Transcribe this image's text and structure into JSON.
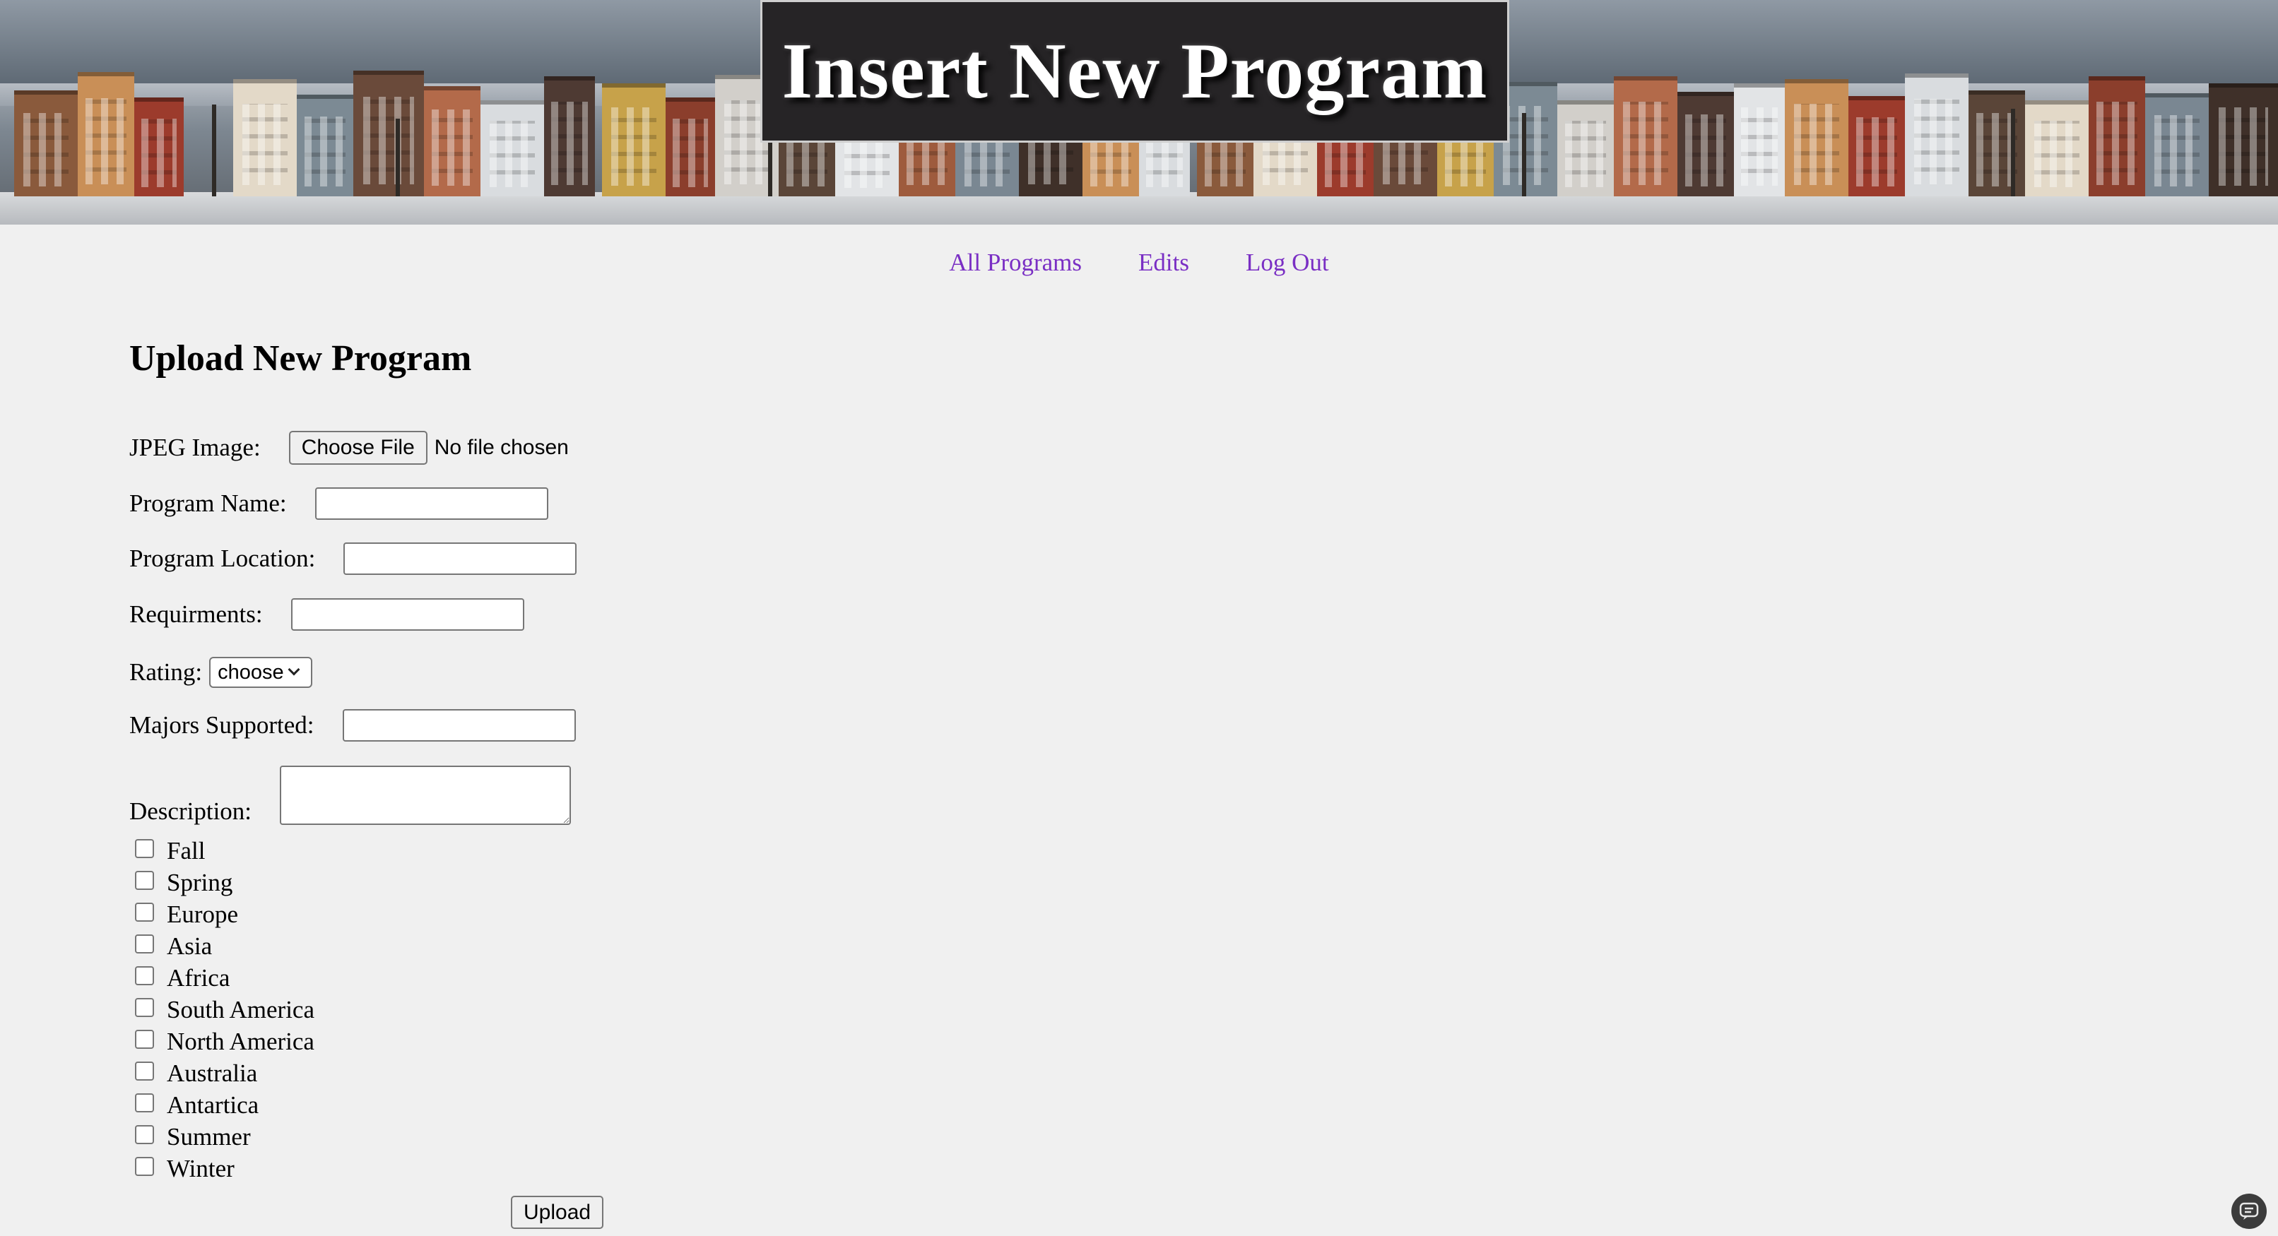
{
  "header": {
    "title": "Insert New Program"
  },
  "nav": {
    "items": [
      {
        "label": "All Programs"
      },
      {
        "label": "Edits"
      },
      {
        "label": "Log Out"
      }
    ]
  },
  "form": {
    "heading": "Upload New Program",
    "jpeg_label": "JPEG Image:",
    "file_button_label": "Choose File",
    "file_status": "No file chosen",
    "program_name_label": "Program Name:",
    "program_name_value": "",
    "program_location_label": "Program Location:",
    "program_location_value": "",
    "requirements_label": "Requirments:",
    "requirements_value": "",
    "rating_label": "Rating:",
    "rating_selected": "choose",
    "majors_label": "Majors Supported:",
    "majors_value": "",
    "description_label": "Description:",
    "description_value": "",
    "checkboxes": [
      {
        "label": "Fall",
        "checked": false
      },
      {
        "label": "Spring",
        "checked": false
      },
      {
        "label": "Europe",
        "checked": false
      },
      {
        "label": "Asia",
        "checked": false
      },
      {
        "label": "Africa",
        "checked": false
      },
      {
        "label": "South America",
        "checked": false
      },
      {
        "label": "North America",
        "checked": false
      },
      {
        "label": "Australia",
        "checked": false
      },
      {
        "label": "Antartica",
        "checked": false
      },
      {
        "label": "Summer",
        "checked": false
      },
      {
        "label": "Winter",
        "checked": false
      }
    ],
    "upload_label": "Upload"
  },
  "colors": {
    "background": "#f0f0f0",
    "link": "#7a2fc4",
    "title_box": "#262426"
  },
  "icons": {
    "corner": "chat-assistant-icon",
    "select_arrow": "chevron-down-icon"
  }
}
